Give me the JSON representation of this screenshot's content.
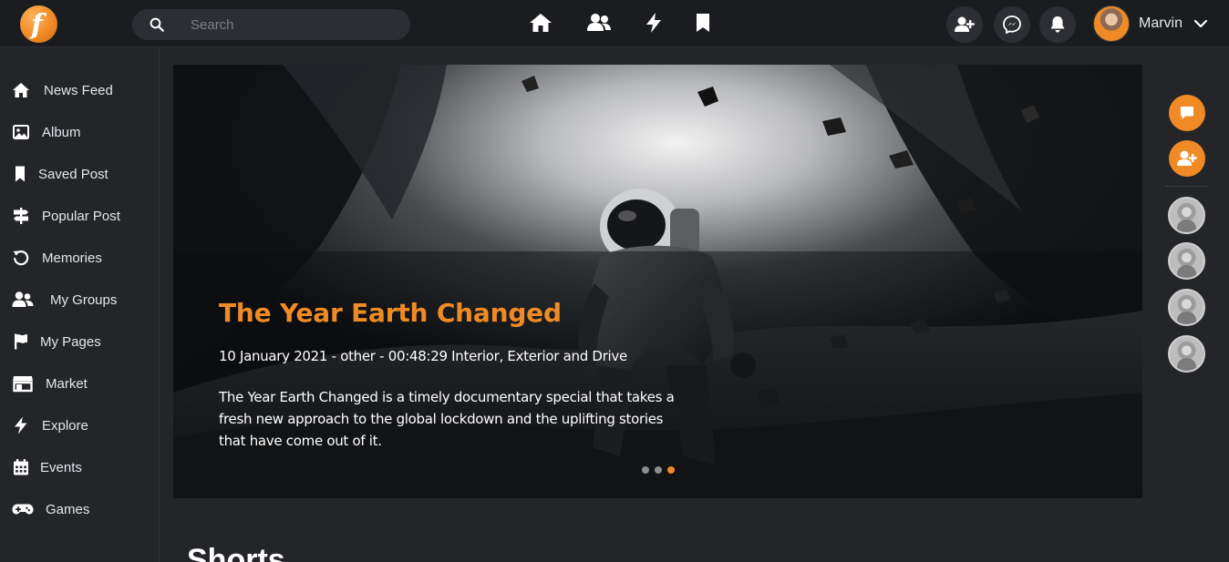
{
  "header": {
    "logo_letter": "f",
    "search_placeholder": "Search",
    "nav_icons": [
      "home-icon",
      "friends-icon",
      "bolt-icon",
      "bookmark-icon"
    ],
    "action_icons": [
      "add-friend-icon",
      "messenger-icon",
      "bell-icon"
    ],
    "user_name": "Marvin"
  },
  "sidebar": {
    "items": [
      {
        "label": "News Feed",
        "icon": "home-icon"
      },
      {
        "label": "Album",
        "icon": "image-icon"
      },
      {
        "label": "Saved Post",
        "icon": "bookmark-icon"
      },
      {
        "label": "Popular Post",
        "icon": "signpost-icon"
      },
      {
        "label": "Memories",
        "icon": "history-icon"
      },
      {
        "label": "My Groups",
        "icon": "group-icon"
      },
      {
        "label": "My Pages",
        "icon": "flag-icon"
      },
      {
        "label": "Market",
        "icon": "store-icon"
      },
      {
        "label": "Explore",
        "icon": "bolt-icon"
      },
      {
        "label": "Events",
        "icon": "calendar-icon"
      },
      {
        "label": "Games",
        "icon": "gamepad-icon"
      }
    ]
  },
  "hero": {
    "title": "The Year Earth Changed",
    "meta": "10 January 2021 - other - 00:48:29 Interior, Exterior and Drive",
    "description": "The Year Earth Changed is a timely documentary special that takes a fresh new approach to the global lockdown and the uplifting stories that have come out of it.",
    "slides_total": 3,
    "active_slide": 3
  },
  "section": {
    "title": "Shorts"
  },
  "right_rail": {
    "buttons": [
      "chat-icon",
      "add-friend-icon"
    ],
    "contacts_count": 4
  },
  "colors": {
    "accent": "#f08a24",
    "background": "#232529",
    "topbar": "#1b1c1f"
  }
}
